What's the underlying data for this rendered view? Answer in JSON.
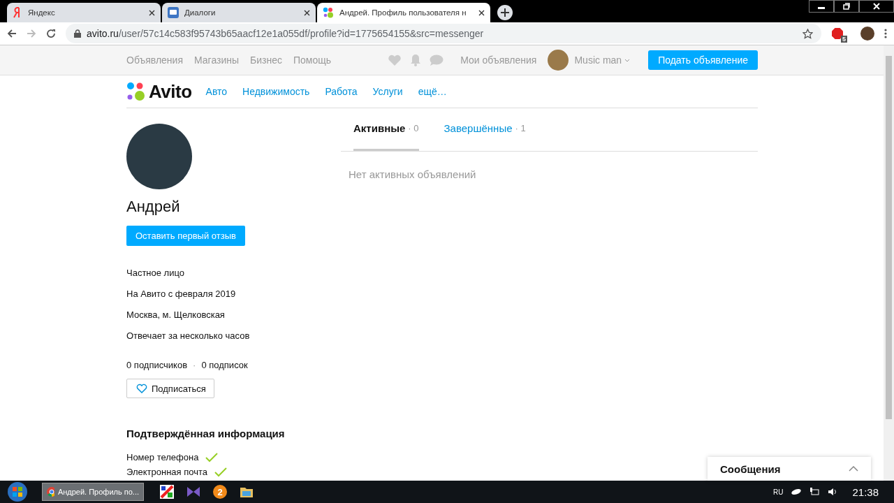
{
  "browser": {
    "tabs": [
      {
        "kind": "yandex",
        "title": "Яндекс",
        "selected": false
      },
      {
        "kind": "chat",
        "title": "Диалоги",
        "selected": false
      },
      {
        "kind": "avito",
        "title": "Андрей. Профиль пользователя н",
        "selected": true
      }
    ],
    "address": {
      "host": "avito.ru",
      "path": "/user/57c14c583f95743b65aacf12e1a055df/profile?id=1775654155&src=messenger"
    },
    "extension_badge": "5"
  },
  "top_nav": {
    "links": [
      "Объявления",
      "Магазины",
      "Бизнес",
      "Помощь"
    ],
    "my_ads": "Мои объявления",
    "user_name": "Music man",
    "post_button": "Подать объявление"
  },
  "category_nav": {
    "logo": "Avito",
    "links": [
      "Авто",
      "Недвижимость",
      "Работа",
      "Услуги",
      "ещё…"
    ]
  },
  "profile": {
    "name": "Андрей",
    "review_button": "Оставить первый отзыв",
    "info": [
      "Частное лицо",
      "На Авито с февраля 2019",
      "Москва, м. Щелковская",
      "Отвечает за несколько часов"
    ],
    "followers": "0 подписчиков",
    "separator": "·",
    "following": "0 подписок",
    "subscribe_button": "Подписаться",
    "verified_title": "Подтверждённая информация",
    "verified": [
      {
        "label": "Номер телефона",
        "checked": true
      },
      {
        "label": "Электронная почта",
        "checked": true
      }
    ]
  },
  "listing_tabs": [
    {
      "label": "Активные",
      "separator": "·",
      "count": "0",
      "selected": true
    },
    {
      "label": "Завершённые",
      "separator": "·",
      "count": "1",
      "selected": false
    }
  ],
  "empty_message": "Нет активных объявлений",
  "messages_panel": {
    "title": "Сообщения"
  },
  "taskbar": {
    "window_title": "Андрей. Профиль по...",
    "apps": [
      {
        "kind": "paint"
      },
      {
        "kind": "studio"
      },
      {
        "kind": "badge",
        "label": "2"
      },
      {
        "kind": "folder"
      }
    ],
    "language": "RU",
    "time": "21:38"
  }
}
